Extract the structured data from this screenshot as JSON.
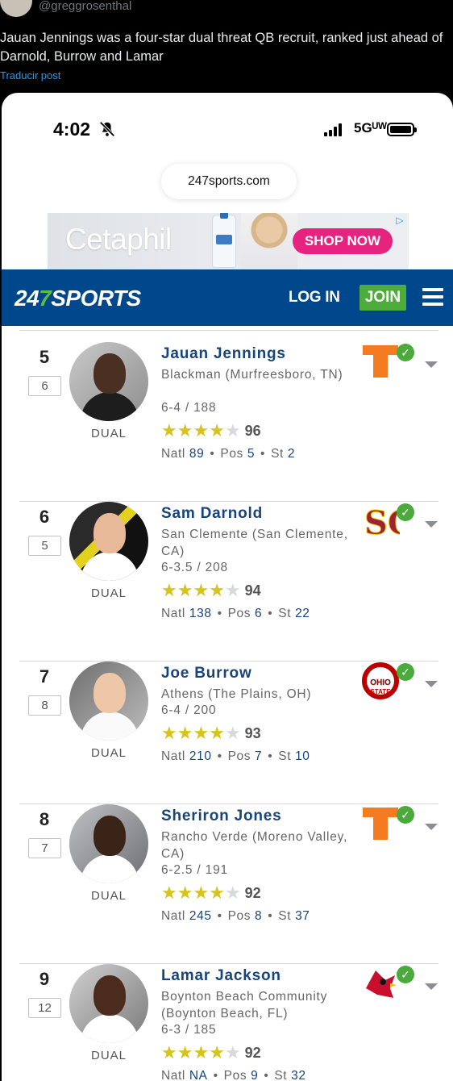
{
  "tweet": {
    "handle": "@greggrosenthal",
    "text": "Jauan Jennings was a four-star dual threat QB recruit, ranked just ahead of Darnold, Burrow and Lamar",
    "translate_link": "Traducir post"
  },
  "status_bar": {
    "time": "4:02",
    "network": "5Gᵁᵂ"
  },
  "browser": {
    "url": "247sports.com"
  },
  "ad": {
    "brand": "Cetaphil",
    "cta": "SHOP NOW"
  },
  "nav": {
    "logo_a": "24",
    "logo_b": "7",
    "logo_c": "SPORTS",
    "login": "LOG IN",
    "join": "JOIN"
  },
  "recruits": [
    {
      "rank": "5",
      "prev": "6",
      "name": "Jauan Jennings",
      "hometown": "Blackman (Murfreesboro, TN)",
      "hw": "6-4 / 188",
      "position": "DUAL",
      "stars": 4,
      "score": "96",
      "natl": "89",
      "pos": "5",
      "st": "2",
      "team": "tennessee"
    },
    {
      "rank": "6",
      "prev": "5",
      "name": "Sam Darnold",
      "hometown": "San Clemente (San Clemente, CA)",
      "hw": "6-3.5 / 208",
      "position": "DUAL",
      "stars": 4,
      "score": "94",
      "natl": "138",
      "pos": "6",
      "st": "22",
      "team": "usc"
    },
    {
      "rank": "7",
      "prev": "8",
      "name": "Joe Burrow",
      "hometown": "Athens (The Plains, OH)",
      "hw": "6-4 / 200",
      "position": "DUAL",
      "stars": 4,
      "score": "93",
      "natl": "210",
      "pos": "7",
      "st": "10",
      "team": "ohio-state"
    },
    {
      "rank": "8",
      "prev": "7",
      "name": "Sheriron Jones",
      "hometown": "Rancho Verde (Moreno Valley, CA)",
      "hw": "6-2.5 / 191",
      "position": "DUAL",
      "stars": 4,
      "score": "92",
      "natl": "245",
      "pos": "8",
      "st": "37",
      "team": "tennessee"
    },
    {
      "rank": "9",
      "prev": "12",
      "name": "Lamar Jackson",
      "hometown": "Boynton Beach Community (Boynton Beach, FL)",
      "hw": "6-3 / 185",
      "position": "DUAL",
      "stars": 4,
      "score": "92",
      "natl": "NA",
      "pos": "9",
      "st": "32",
      "team": "louisville"
    }
  ],
  "labels": {
    "natl": "Natl",
    "pos": "Pos",
    "st": "St",
    "sep": "•"
  },
  "colors": {
    "nav_blue": "#00478c",
    "join_green": "#4eac3c",
    "link_blue": "#17447c",
    "star_gold": "#d7c31e",
    "check_green": "#4aaa3b",
    "ad_pink": "#e6247f"
  }
}
